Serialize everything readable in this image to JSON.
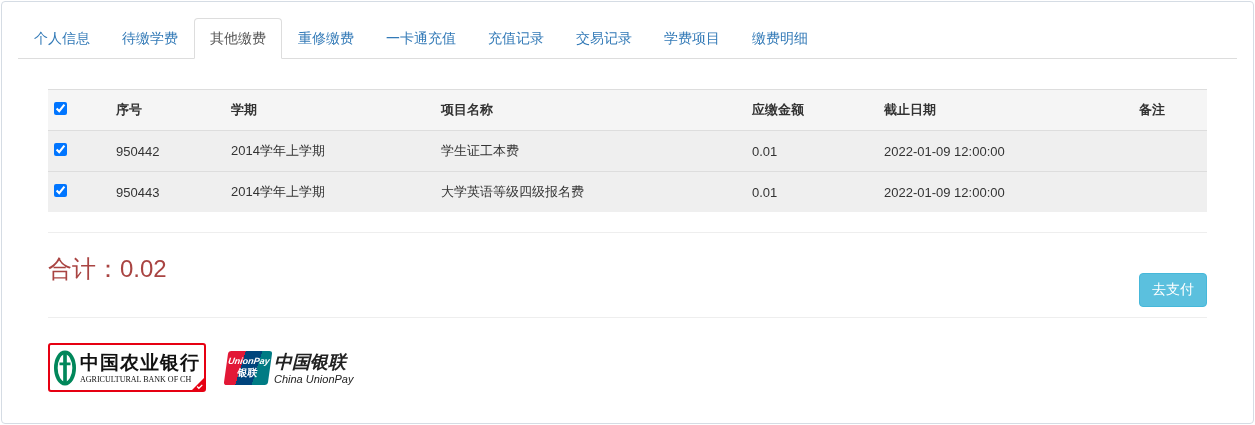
{
  "tabs": [
    {
      "label": "个人信息",
      "selected": false
    },
    {
      "label": "待缴学费",
      "selected": false
    },
    {
      "label": "其他缴费",
      "selected": true
    },
    {
      "label": "重修缴费",
      "selected": false
    },
    {
      "label": "一卡通充值",
      "selected": false
    },
    {
      "label": "充值记录",
      "selected": false
    },
    {
      "label": "交易记录",
      "selected": false
    },
    {
      "label": "学费项目",
      "selected": false
    },
    {
      "label": "缴费明细",
      "selected": false
    }
  ],
  "table": {
    "select_all_checked": true,
    "columns": [
      "序号",
      "学期",
      "项目名称",
      "应缴金额",
      "截止日期",
      "备注"
    ],
    "rows": [
      {
        "checked": true,
        "cells": [
          "950442",
          "2014学年上学期",
          "学生证工本费",
          "0.01",
          "2022-01-09 12:00:00"
        ]
      },
      {
        "checked": true,
        "cells": [
          "950443",
          "2014学年上学期",
          "大学英语等级四级报名费",
          "0.01",
          "2022-01-09 12:00:00"
        ]
      }
    ]
  },
  "total": "合计：0.02",
  "pay_button": "去支付",
  "payment_options": [
    {
      "kind": "abc",
      "selected": true,
      "name": "中国农业银行",
      "subtitle": "AGRICULTURAL BANK OF CH"
    },
    {
      "kind": "unionpay",
      "selected": false,
      "badge_top": "UnionPay",
      "badge_bottom": "银联",
      "name": "中国银联",
      "subtitle": "China UnionPay"
    }
  ]
}
